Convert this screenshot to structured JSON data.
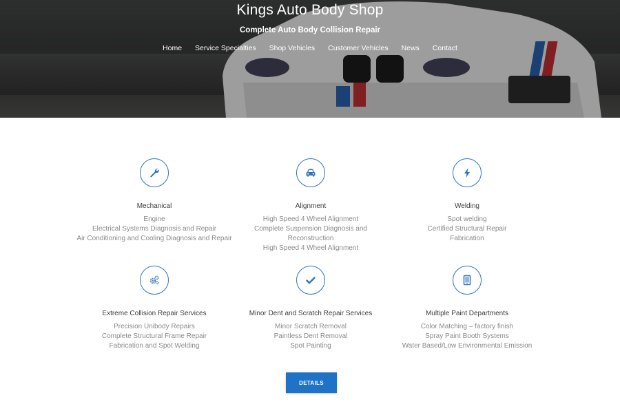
{
  "header": {
    "title": "Kings Auto Body Shop",
    "tagline": "Complete Auto Body Collision Repair",
    "nav": [
      "Home",
      "Service Specialties",
      "Shop Vehicles",
      "Customer Vehicles",
      "News",
      "Contact"
    ]
  },
  "services": [
    {
      "title": "Mechanical",
      "icon": "wrench-icon",
      "lines": [
        "Engine",
        "Electrical Systems Diagnosis and Repair",
        "Air Conditioning and Cooling Diagnosis and Repair"
      ]
    },
    {
      "title": "Alignment",
      "icon": "car-icon",
      "lines": [
        "High Speed 4 Wheel Alignment",
        "Complete Suspension Diagnosis and Reconstruction",
        "High Speed 4 Wheel Alignment"
      ]
    },
    {
      "title": "Welding",
      "icon": "lightning-icon",
      "lines": [
        "Spot welding",
        "Certified Structural Repair",
        "Fabrication"
      ]
    },
    {
      "title": "Extreme Collision Repair Services",
      "icon": "gears-icon",
      "lines": [
        "Precision Unibody Repairs",
        "Complete Structural Frame Repair",
        "Fabrication and Spot Welding"
      ]
    },
    {
      "title": "Minor Dent and Scratch Repair Services",
      "icon": "checkmark-icon",
      "lines": [
        "Minor Scratch Removal",
        "Paintless Dent Removal",
        "Spot Painting"
      ]
    },
    {
      "title": "Multiple Paint Departments",
      "icon": "tablet-icon",
      "lines": [
        "Color Matching – factory finish",
        "Spray Paint Booth Systems",
        "Water Based/Low Environmental Emission"
      ]
    }
  ],
  "details_button": "DETAILS",
  "colors": {
    "accent": "#1e73c6",
    "icon_border": "#2f73bf"
  }
}
